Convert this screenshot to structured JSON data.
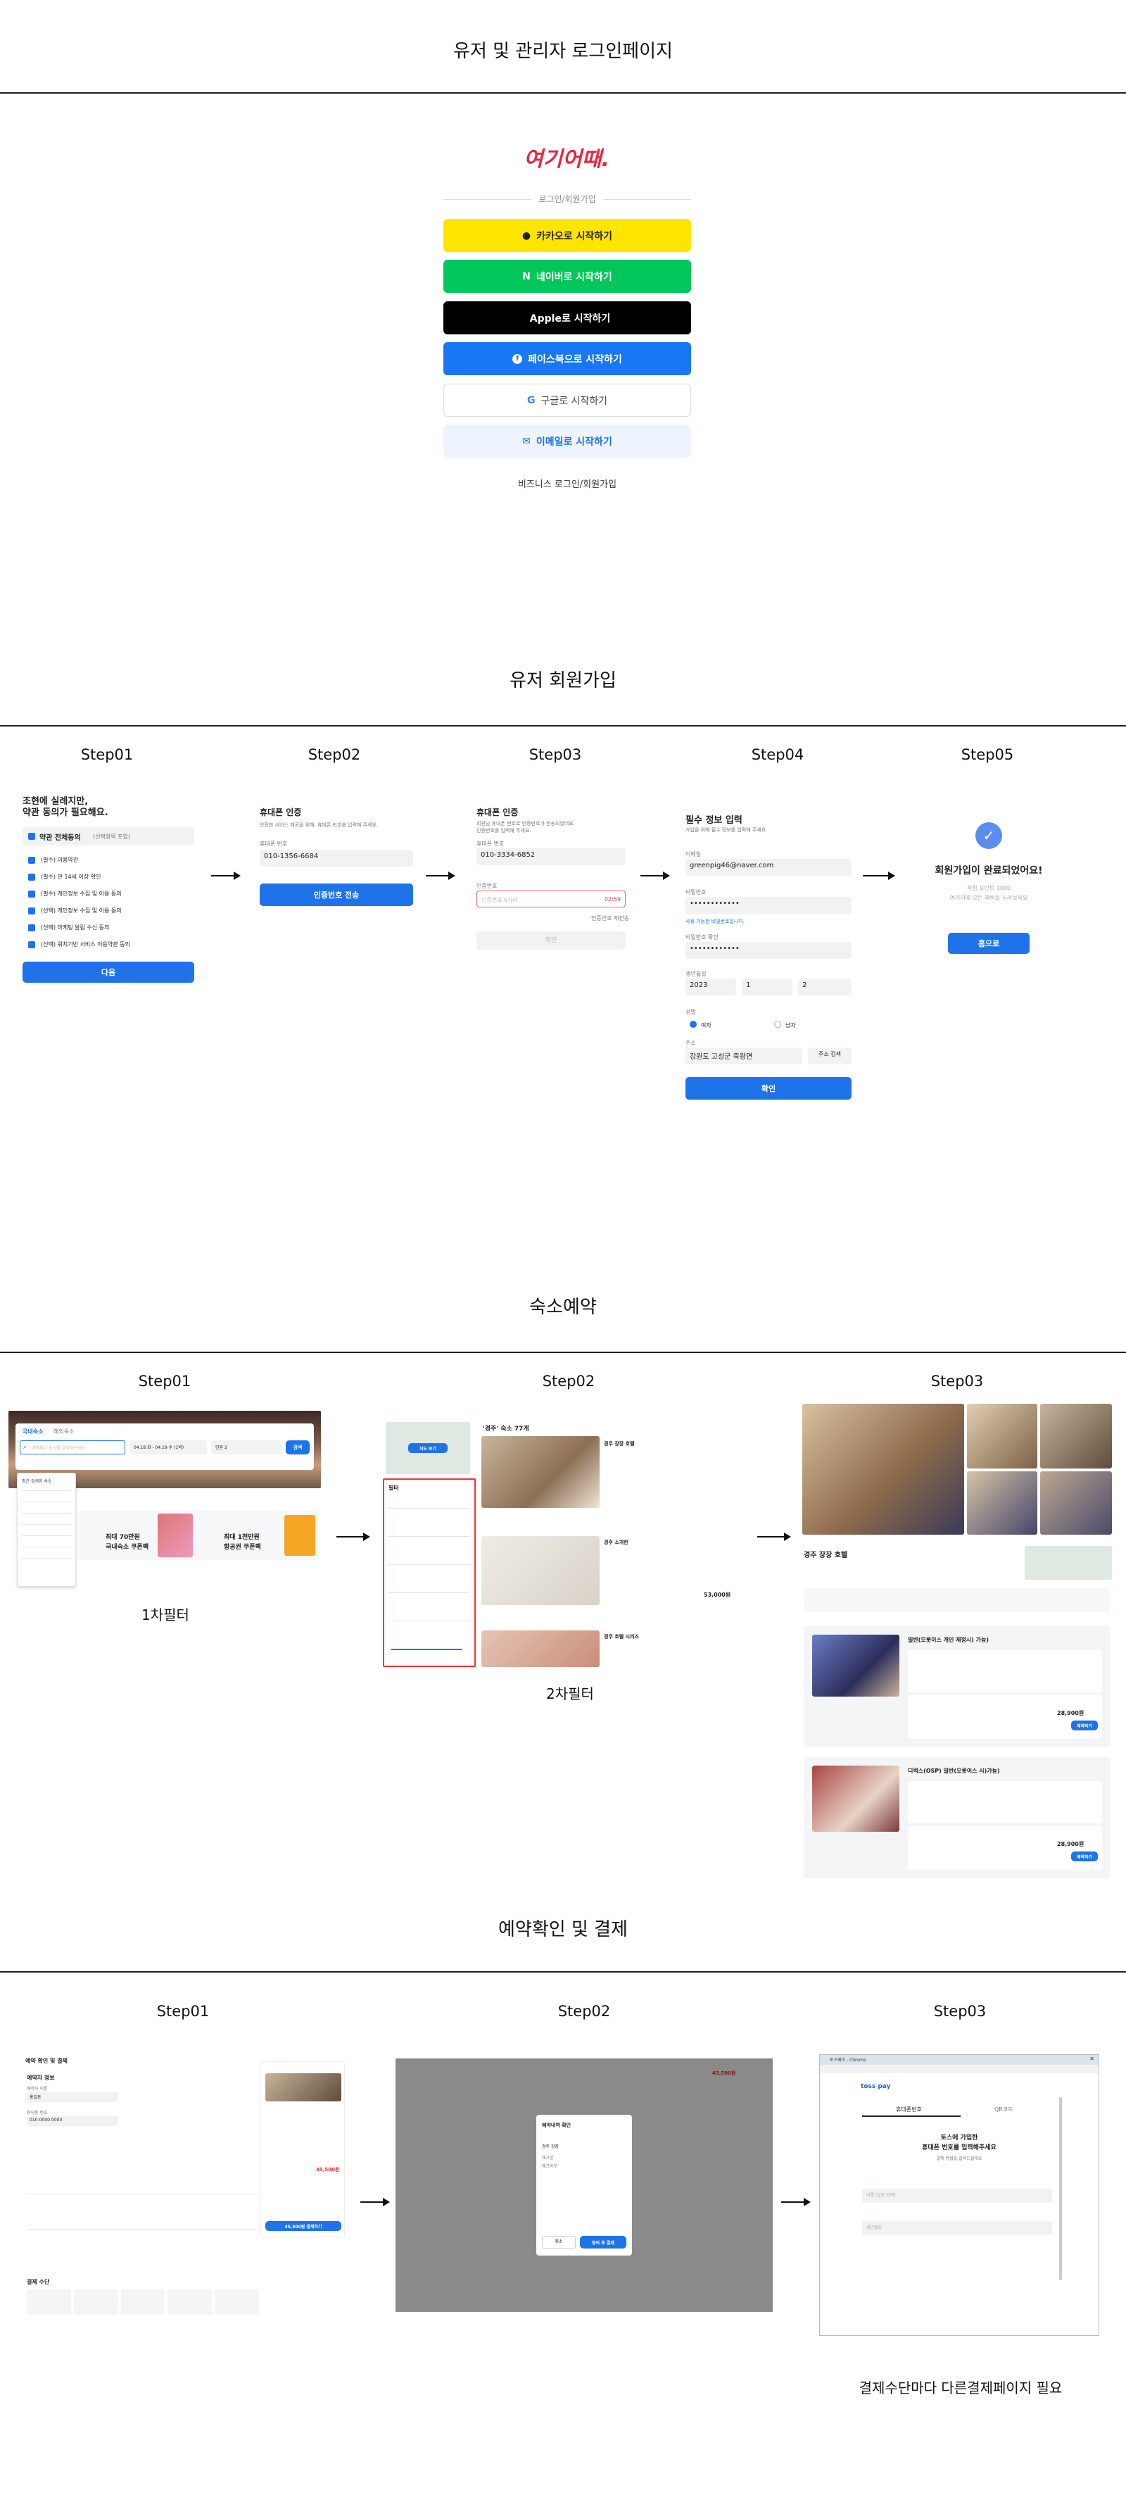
{
  "sections": {
    "login": "유저 및 관리자 로그인페이지",
    "signup": "유저 회원가입",
    "booking": "숙소예약",
    "payment": "예약확인 및 결제"
  },
  "login": {
    "logo": "여기어때.",
    "divider": "로그인/회원가입",
    "kakao": "카카오로 시작하기",
    "naver": "네이버로 시작하기",
    "apple": "Apple로 시작하기",
    "facebook": "페이스북으로 시작하기",
    "google": "구글로 시작하기",
    "email": "이메일로 시작하기",
    "business": "비즈니스 로그인/회원가입",
    "colors": {
      "kakao": "#FEE500",
      "naver": "#03C75A",
      "apple": "#000000",
      "facebook": "#1877F2",
      "email_bg": "#EEF4FE"
    }
  },
  "steps": {
    "s1": "Step01",
    "s2": "Step02",
    "s3": "Step03",
    "s4": "Step04",
    "s5": "Step05"
  },
  "signup": {
    "s1": {
      "title1": "조현에 실례지만,",
      "title2": "약관 동의가 필요해요.",
      "all": "약관 전체동의",
      "all_sub": "(선택항목 포함)",
      "items": [
        "(필수) 이용약관",
        "(필수) 만 14세 이상 확인",
        "(필수) 개인정보 수집 및 이용 동의",
        "(선택) 개인정보 수집 및 이용 동의",
        "(선택) 마케팅 알림 수신 동의",
        "(선택) 위치기반 서비스 이용약관 동의"
      ],
      "next": "다음"
    },
    "s2": {
      "title": "휴대폰 인증",
      "desc": "안전한 서비스 제공을 위해, 휴대폰 번호를 입력해 주세요.",
      "label": "휴대폰 번호",
      "phone": "010-1356-6684",
      "btn": "인증번호 전송"
    },
    "s3": {
      "title": "휴대폰 인증",
      "desc": "회원님 휴대폰 번호로 인증번호가 전송되었어요.",
      "desc2": "인증번호를 입력해 주세요.",
      "label": "휴대폰 번호",
      "phone": "010-3334-6852",
      "label2": "인증번호",
      "placeholder": "인증번호 6자리",
      "timer": "02:59",
      "resend": "인증번호 재전송",
      "btn": "확인"
    },
    "s4": {
      "title": "필수 정보 입력",
      "desc": "가입을 위해 필수 정보를 입력해 주세요.",
      "email_label": "이메일",
      "email": "greenpig46@naver.com",
      "pw_label": "비밀번호",
      "pw": "••••••••••••",
      "pw_hint": "사용 가능한 비밀번호입니다.",
      "pw2_label": "비밀번호 확인",
      "pw2": "••••••••••••",
      "birth_label": "생년월일",
      "year": "2023",
      "month": "1",
      "day": "2",
      "gender_label": "성별",
      "female": "여자",
      "male": "남자",
      "addr_label": "주소",
      "addr": "강원도 고성군 죽왕면",
      "addr_btn": "주소 검색",
      "btn": "확인"
    },
    "s5": {
      "title": "회원가입이 완료되었어요!",
      "line1": "적립 포인트 1000",
      "line2": "여기어때 모든 혜택을 누려보세요",
      "btn": "홈으로"
    }
  },
  "booking": {
    "filter1": "1차필터",
    "filter2": "2차필터",
    "s1": {
      "tab1": "국내숙소",
      "tab2": "해외숙소",
      "search": "여행지나 숙소를 검색해보세요",
      "date": "04.18 화 - 04.19 수 (1박)",
      "guests": "인원 2",
      "btn": "검색",
      "banner1": "최대 70만원",
      "banner1b": "국내숙소 쿠폰팩",
      "banner2": "최대 1천만원",
      "banner2b": "항공권 쿠폰팩",
      "recent": "최근 검색한 숙소"
    },
    "s2": {
      "title": "'경주' 숙소 77개",
      "map_btn": "지도 보기",
      "filter_title": "필터",
      "list": [
        "경주 장장 호텔",
        "경주 소개한",
        "경주 호텔 시리즈"
      ],
      "price": "53,000원"
    },
    "s3": {
      "name": "경주 장장 호텔",
      "rooms": [
        "일반(오롯이스 개인 제정시) 가능)",
        "디럭스(OSP) 일반(오롯이스 시)가능)"
      ],
      "price1": "28,900원",
      "price2": "28,900원",
      "reserve": "예약하기"
    }
  },
  "payment": {
    "caption": "결제수단마다 다른결제페이지 필요",
    "s1": {
      "back": "예약 확인 및 결제",
      "section": "예약자 정보",
      "name_label": "예약자 이름",
      "name": "홍길동",
      "phone_label": "휴대폰 번호",
      "phone": "010-0000-0000",
      "method": "결제 수단",
      "pay_btn": "45,500원 결제하기",
      "total": "45,500원"
    },
    "s2": {
      "modal_title": "예약내역 확인",
      "hotel": "경주 장장",
      "checkin": "체크인",
      "checkout": "체크아웃",
      "cancel": "취소",
      "confirm": "동의 후 결제",
      "amount": "45,500원"
    },
    "s3": {
      "window_title": "토스페이 - Chrome",
      "brand": "toss pay",
      "tab1": "휴대폰번호",
      "tab2": "QR코드",
      "title": "토스에 가입한",
      "title2": "휴대폰 번호를 입력해주세요",
      "sub": "결제 방법을 알려드릴게요",
      "name_ph": "이름 (실명 입력)",
      "birth_ph": "생년월일"
    }
  }
}
